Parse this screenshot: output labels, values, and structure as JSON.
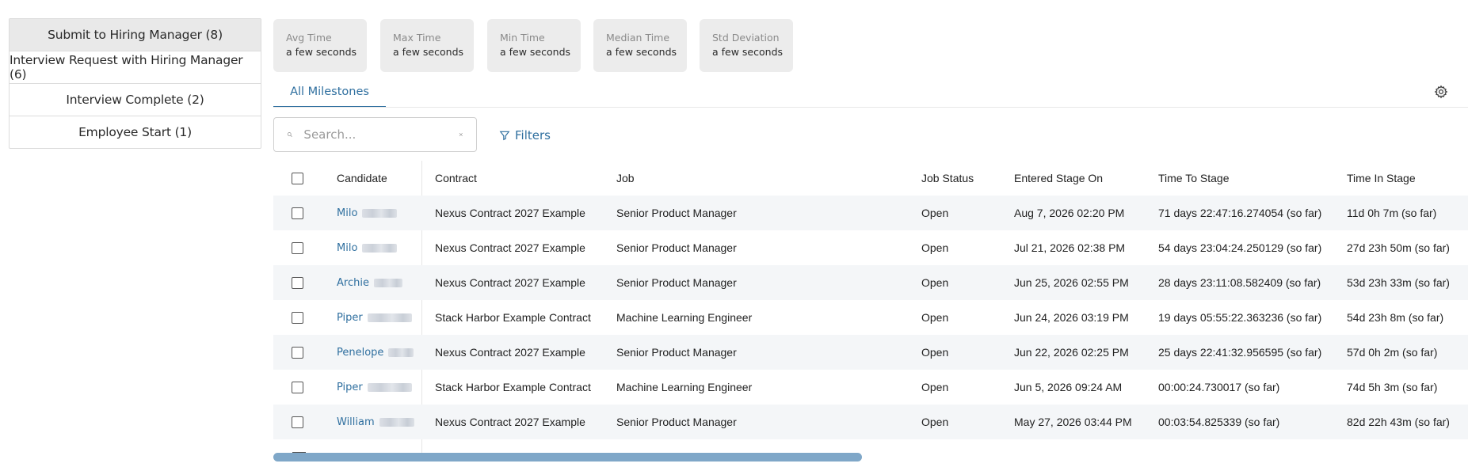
{
  "stages": [
    {
      "label": "Submit to Hiring Manager (8)"
    },
    {
      "label": "Interview Request with Hiring Manager (6)"
    },
    {
      "label": "Interview Complete (2)"
    },
    {
      "label": "Employee Start (1)"
    }
  ],
  "stats": [
    {
      "label": "Avg Time",
      "value": "a few seconds"
    },
    {
      "label": "Max Time",
      "value": "a few seconds"
    },
    {
      "label": "Min Time",
      "value": "a few seconds"
    },
    {
      "label": "Median Time",
      "value": "a few seconds"
    },
    {
      "label": "Std Deviation",
      "value": "a few seconds"
    }
  ],
  "tabs": [
    {
      "label": "All Milestones",
      "active": true
    }
  ],
  "search": {
    "placeholder": "Search..."
  },
  "filters": {
    "label": "Filters"
  },
  "table": {
    "columns": [
      "Candidate",
      "Contract",
      "Job",
      "Job Status",
      "Entered Stage On",
      "Time To Stage",
      "Time In Stage"
    ],
    "rows": [
      {
        "candidate": "Milo",
        "contract": "Nexus Contract 2027 Example",
        "job": "Senior Product Manager",
        "status": "Open",
        "entered": "Aug 7, 2026 02:20 PM",
        "time_to": "71 days 22:47:16.274054 (so far)",
        "time_in": "11d 0h 7m (so far)"
      },
      {
        "candidate": "Milo",
        "contract": "Nexus Contract 2027 Example",
        "job": "Senior Product Manager",
        "status": "Open",
        "entered": "Jul 21, 2026 02:38 PM",
        "time_to": "54 days 23:04:24.250129 (so far)",
        "time_in": "27d 23h 50m (so far)"
      },
      {
        "candidate": "Archie",
        "contract": "Nexus Contract 2027 Example",
        "job": "Senior Product Manager",
        "status": "Open",
        "entered": "Jun 25, 2026 02:55 PM",
        "time_to": "28 days 23:11:08.582409 (so far)",
        "time_in": "53d 23h 33m (so far)"
      },
      {
        "candidate": "Piper",
        "contract": "Stack Harbor Example Contract",
        "job": "Machine Learning Engineer",
        "status": "Open",
        "entered": "Jun 24, 2026 03:19 PM",
        "time_to": "19 days 05:55:22.363236 (so far)",
        "time_in": "54d 23h 8m (so far)"
      },
      {
        "candidate": "Penelope",
        "contract": "Nexus Contract 2027 Example",
        "job": "Senior Product Manager",
        "status": "Open",
        "entered": "Jun 22, 2026 02:25 PM",
        "time_to": "25 days 22:41:32.956595 (so far)",
        "time_in": "57d 0h 2m (so far)"
      },
      {
        "candidate": "Piper",
        "contract": "Stack Harbor Example Contract",
        "job": "Machine Learning Engineer",
        "status": "Open",
        "entered": "Jun 5, 2026 09:24 AM",
        "time_to": "00:00:24.730017 (so far)",
        "time_in": "74d 5h 3m (so far)"
      },
      {
        "candidate": "William",
        "contract": "Nexus Contract 2027 Example",
        "job": "Senior Product Manager",
        "status": "Open",
        "entered": "May 27, 2026 03:44 PM",
        "time_to": "00:03:54.825339 (so far)",
        "time_in": "82d 22h 43m (so far)"
      }
    ]
  },
  "icons": {
    "search": "search-icon",
    "clear": "close-icon",
    "filter": "filter-icon",
    "settings": "gear-icon"
  },
  "colors": {
    "accent": "#2f6f9f",
    "scrollbar": "#7fa7c8"
  }
}
